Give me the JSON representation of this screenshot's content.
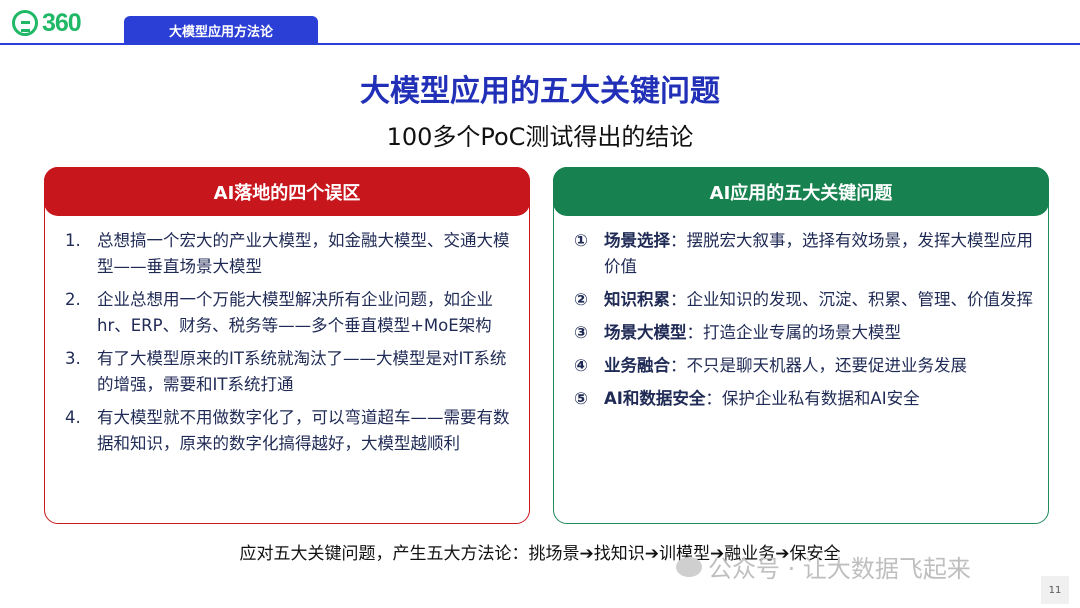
{
  "header": {
    "logo_text": "360",
    "section_tab": "大模型应用方法论"
  },
  "title": "大模型应用的五大关键问题",
  "subtitle": "100多个PoC测试得出的结论",
  "left_panel": {
    "heading": "AI落地的四个误区",
    "items": [
      {
        "num": "1.",
        "text": "总想搞一个宏大的产业大模型，如金融大模型、交通大模型——垂直场景大模型"
      },
      {
        "num": "2.",
        "text": "企业总想用一个万能大模型解决所有企业问题，如企业hr、ERP、财务、税务等——多个垂直模型+MoE架构"
      },
      {
        "num": "3.",
        "text": "有了大模型原来的IT系统就淘汰了——大模型是对IT系统的增强，需要和IT系统打通"
      },
      {
        "num": "4.",
        "text": "有大模型就不用做数字化了，可以弯道超车——需要有数据和知识，原来的数字化搞得越好，大模型越顺利"
      }
    ]
  },
  "right_panel": {
    "heading": "AI应用的五大关键问题",
    "items": [
      {
        "num": "①",
        "keyword": "场景选择",
        "text": "：摆脱宏大叙事，选择有效场景，发挥大模型应用价值"
      },
      {
        "num": "②",
        "keyword": "知识积累",
        "text": "：企业知识的发现、沉淀、积累、管理、价值发挥"
      },
      {
        "num": "③",
        "keyword": "场景大模型",
        "text": "：打造企业专属的场景大模型"
      },
      {
        "num": "④",
        "keyword": "业务融合",
        "text": "：不只是聊天机器人，还要促进业务发展"
      },
      {
        "num": "⑤",
        "keyword": "AI和数据安全",
        "text": "：保护企业私有数据和AI安全"
      }
    ]
  },
  "footer": "应对五大关键问题，产生五大方法论：挑场景➔找知识➔训模型➔融业务➔保安全",
  "watermark": "公众号 · 让大数据飞起来",
  "page_number": "11",
  "colors": {
    "brand_blue": "#2b3fd6",
    "title_blue": "#2230b8",
    "left_red": "#c8161d",
    "right_green": "#17824f",
    "logo_green": "#1fb866"
  }
}
